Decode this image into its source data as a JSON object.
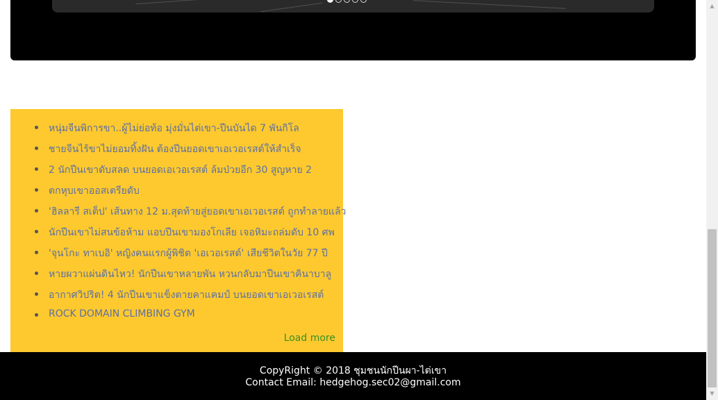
{
  "slider": {
    "dot_count": 5,
    "active_index": 0
  },
  "news": {
    "items": [
      {
        "title": "หนุ่มจีนพิการขา..ผู้ไม่ย่อท้อ มุ่งมั่นไต่เขา-ปีนบันได 7 พันกิโล"
      },
      {
        "title": "ชายจีนไร้ขาไม่ยอมทิ้งฝัน ต้องปีนยอดเขาเอเวอเรสต์ให้สำเร็จ"
      },
      {
        "title": "2 นักปีนเขาดับสลด บนยอดเอเวอเรสต์ ล้มป่วยอีก 30 สูญหาย 2"
      },
      {
        "title": "ตกหุบเขาออสเตรียดับ"
      },
      {
        "title": "'ฮิลลารี สเต็ป' เส้นทาง 12 ม.สุดท้ายสู่ยอดเขาเอเวอเรสต์ ถูกทำลายแล้ว"
      },
      {
        "title": "นักปีนเขาไม่สนข้อห้าม แอบปีนเขามองโกเลีย เจอหิมะถล่มดับ 10 ศพ"
      },
      {
        "title": "'จุนโกะ ทาเบอิ' หญิงคนแรกผู้พิชิต 'เอเวอเรสต์' เสียชีวิตในวัย 77 ปี"
      },
      {
        "title": "หายผวาแผ่นดินไหว! นักปีนเขาหลายพัน หวนกลับมาปีนเขาคินาบาลู"
      },
      {
        "title": "อากาศวิปริต! 4 นักปีนเขาแข็งตายคาแคมป์ บนยอดเขาเอเวอเรสต์"
      },
      {
        "title": "ROCK DOMAIN CLIMBING GYM"
      }
    ],
    "load_more_label": "Load more"
  },
  "footer": {
    "copyright": "CopyRight © 2018 ชุมชนนักปีนผา-ไต่เขา",
    "contact_label": "Contact Email:",
    "contact_email": "hedgehog.sec02@gmail.com"
  },
  "scrollbar": {
    "up_icon": "triangle-up",
    "down_icon": "triangle-down"
  },
  "colors": {
    "news_background": "#fdc92f",
    "link": "#5d6fa3",
    "load_more": "#3b8f23",
    "footer_background": "#000000"
  }
}
